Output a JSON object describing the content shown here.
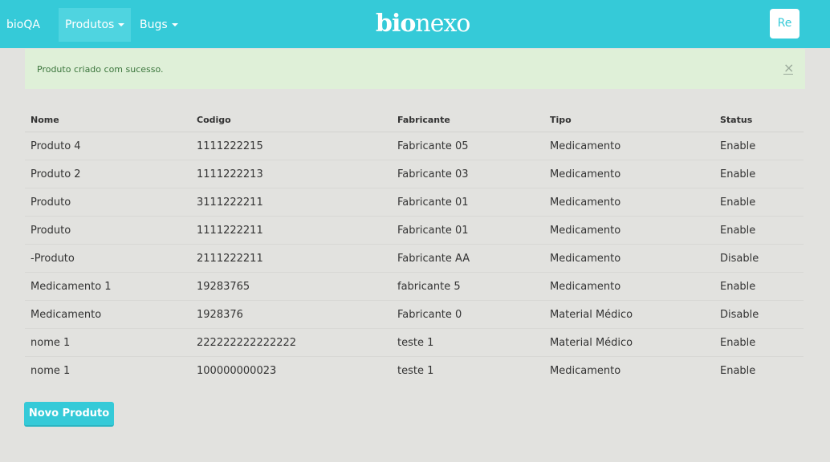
{
  "navbar": {
    "brand": "bioQA",
    "menu_produtos": "Produtos",
    "menu_bugs": "Bugs",
    "logo_bold": "bio",
    "logo_light": "nexo",
    "user_button": "Re"
  },
  "alert": {
    "message": "Produto criado com sucesso.",
    "close": "×"
  },
  "table": {
    "headers": [
      "Nome",
      "Codigo",
      "Fabricante",
      "Tipo",
      "Status"
    ],
    "rows": [
      [
        "Produto 4",
        "1111222215",
        "Fabricante 05",
        "Medicamento",
        "Enable"
      ],
      [
        "Produto 2",
        "1111222213",
        "Fabricante 03",
        "Medicamento",
        "Enable"
      ],
      [
        "Produto",
        "3111222211",
        "Fabricante 01",
        "Medicamento",
        "Enable"
      ],
      [
        "Produto",
        "1111222211",
        "Fabricante 01",
        "Medicamento",
        "Enable"
      ],
      [
        "-Produto",
        "2111222211",
        "Fabricante AA",
        "Medicamento",
        "Disable"
      ],
      [
        "Medicamento 1",
        "19283765",
        "fabricante 5",
        "Medicamento",
        "Enable"
      ],
      [
        "Medicamento",
        "1928376",
        "Fabricante 0",
        "Material Médico",
        "Disable"
      ],
      [
        "nome 1",
        "222222222222222",
        "teste 1",
        "Material Médico",
        "Enable"
      ],
      [
        "nome 1",
        "100000000023",
        "teste 1",
        "Medicamento",
        "Enable"
      ]
    ]
  },
  "actions": {
    "new_product": "Novo Produto"
  }
}
